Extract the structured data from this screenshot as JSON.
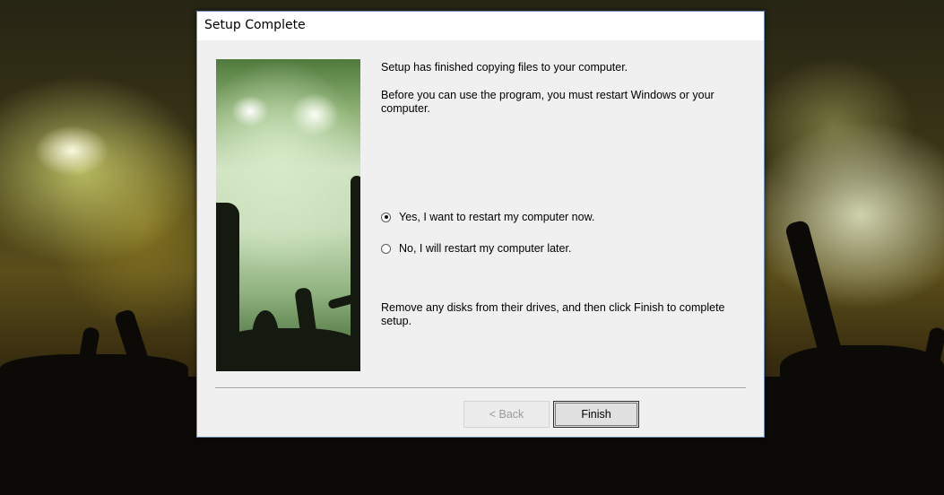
{
  "dialog": {
    "title": "Setup Complete",
    "message1": "Setup has finished copying files to your computer.",
    "message2": "Before you can use the program, you must restart Windows or your computer.",
    "options": [
      {
        "label": "Yes, I want to restart my computer now.",
        "selected": true
      },
      {
        "label": "No, I will restart my computer later.",
        "selected": false
      }
    ],
    "message3": "Remove any disks from their drives, and then click Finish to complete setup.",
    "buttons": {
      "back_label": "< Back",
      "back_enabled": false,
      "finish_label": "Finish"
    }
  },
  "colors": {
    "dialog_border": "#6b8fb8",
    "dialog_bg": "#f0f0f0"
  },
  "icons": {
    "radio_selected": "radio-selected-icon",
    "radio_unselected": "radio-unselected-icon"
  }
}
